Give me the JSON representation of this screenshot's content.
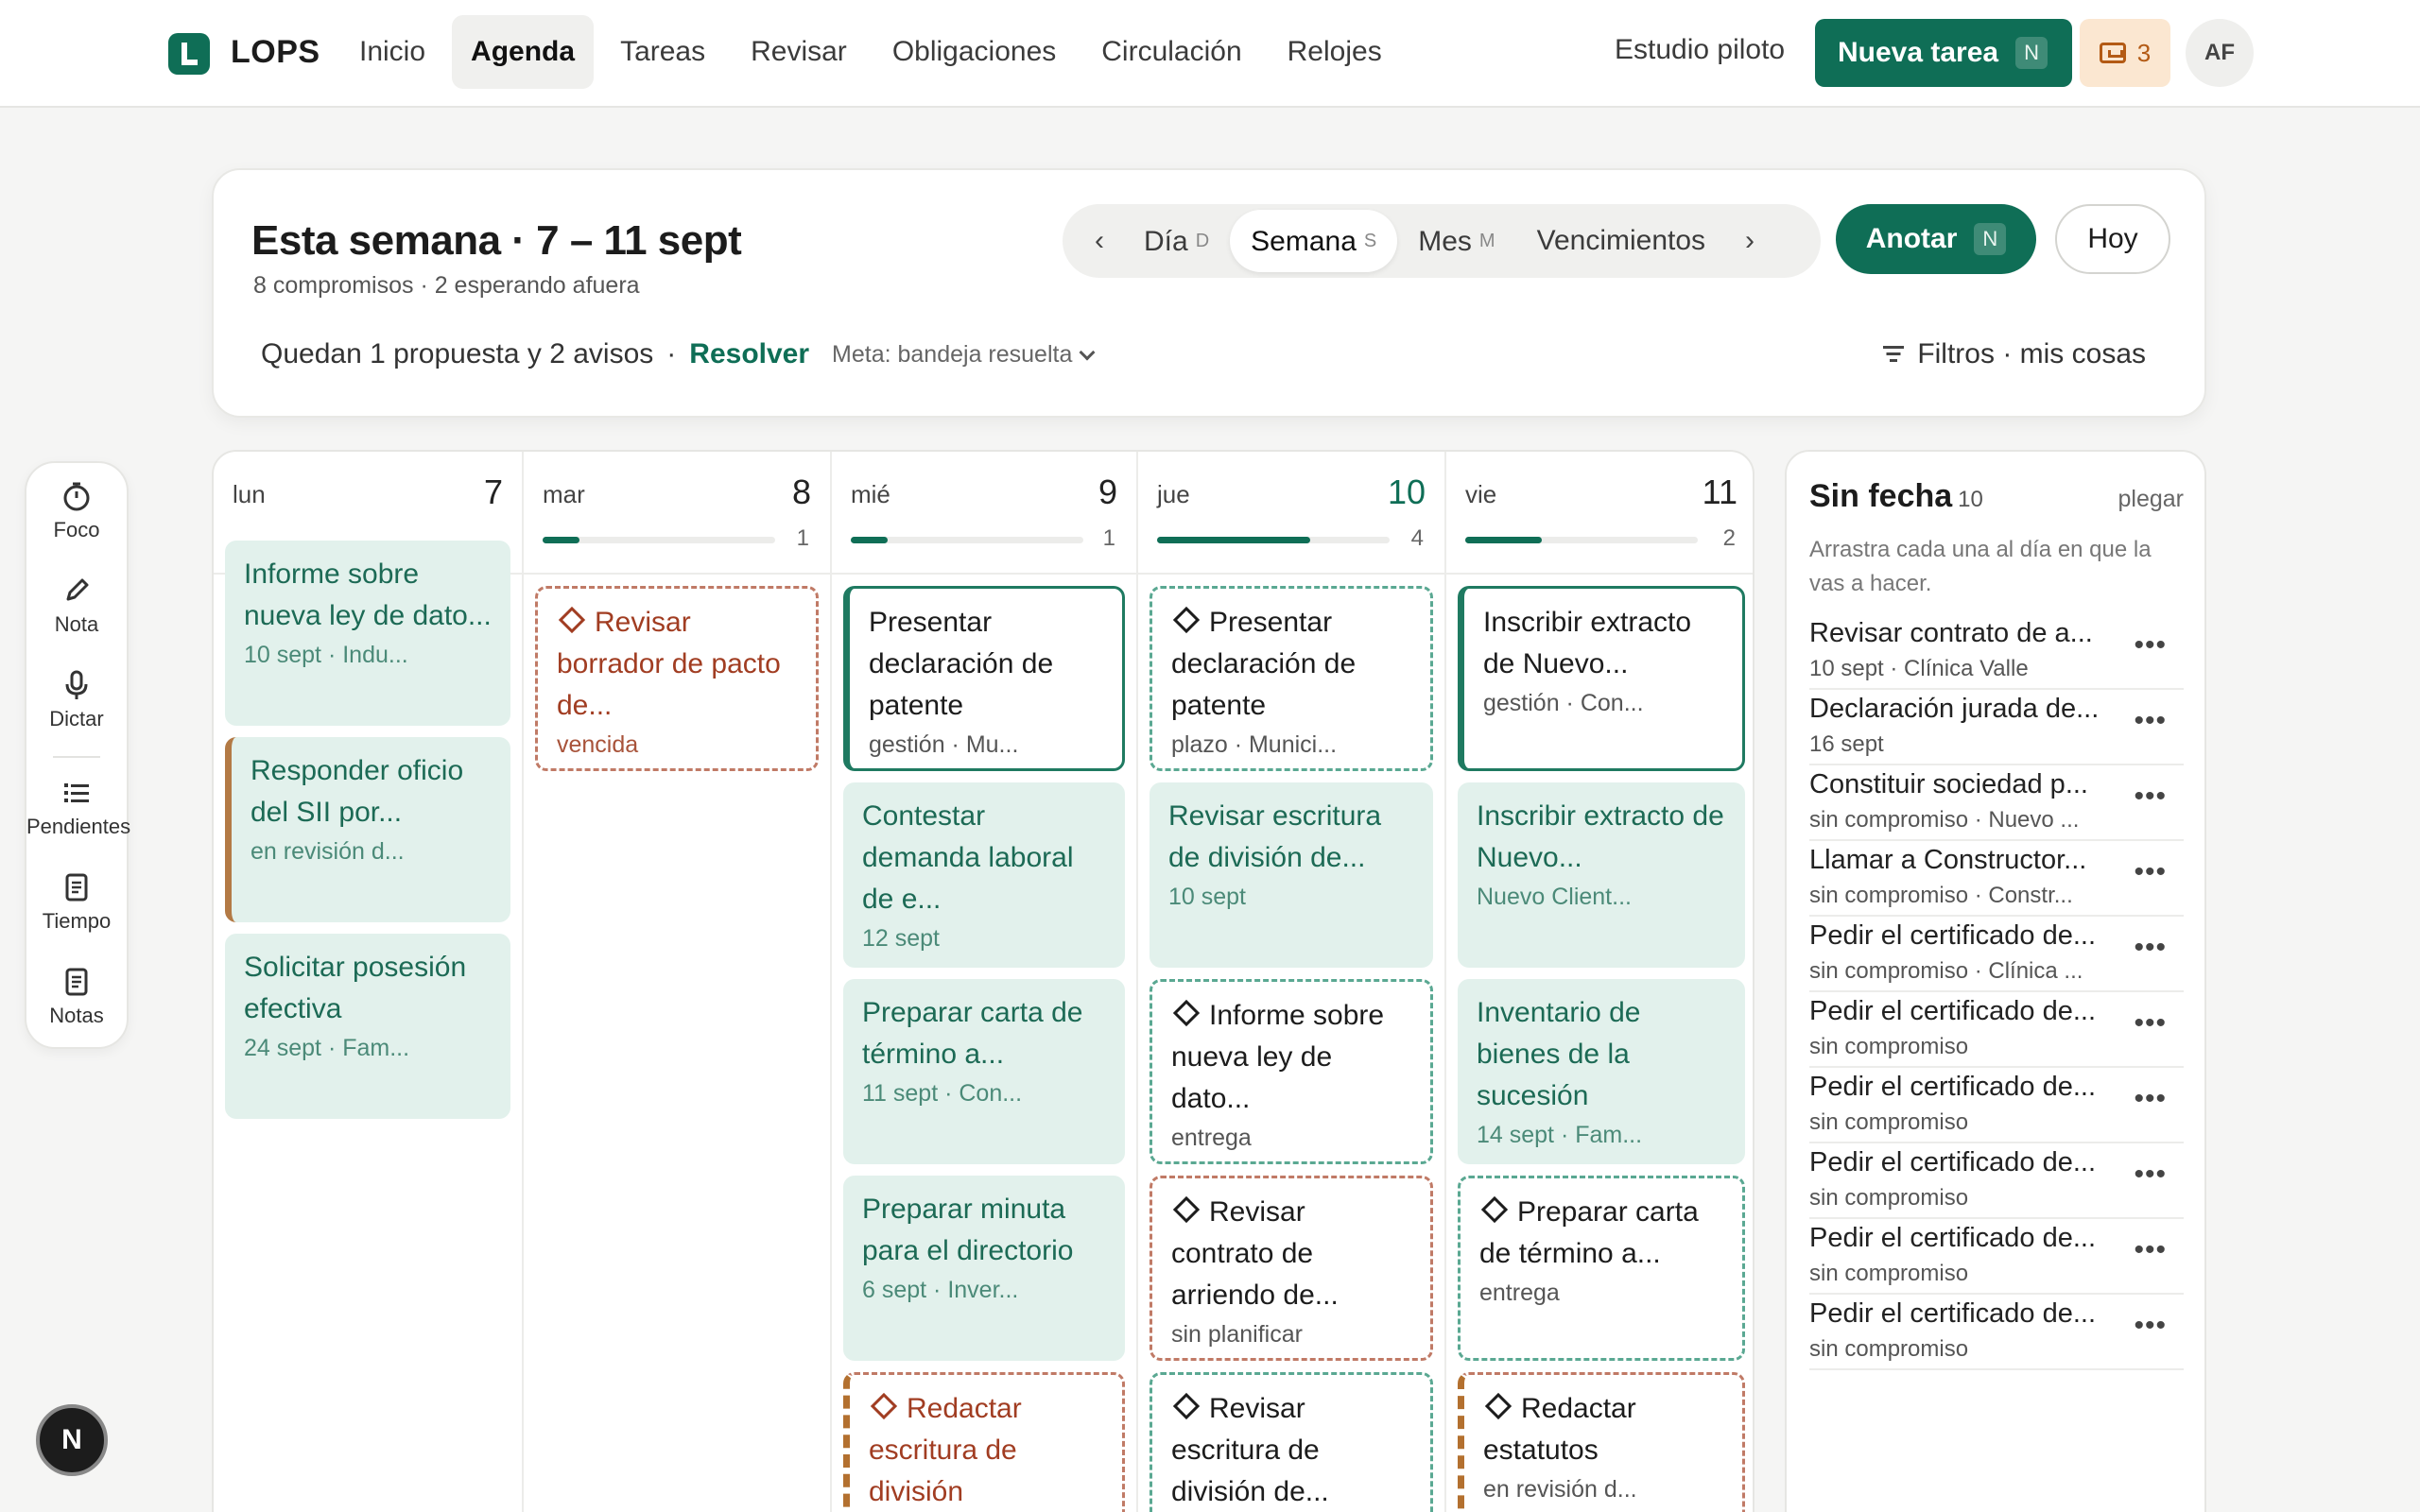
{
  "app": {
    "brand": "LOPS",
    "nav": [
      "Inicio",
      "Agenda",
      "Tareas",
      "Revisar",
      "Obligaciones",
      "Circulación",
      "Relojes"
    ],
    "workspace": "Estudio piloto",
    "new_task_label": "Nueva tarea",
    "new_task_shortcut": "N",
    "inbox_count": "3",
    "avatar_initials": "AF",
    "accent_color": "#0f6e56"
  },
  "header": {
    "title": "Esta semana · 7 – 11 sept",
    "subtitle": "8 compromisos · 2 esperando afuera",
    "prev": "‹",
    "next": "›",
    "views": [
      {
        "label": "Día",
        "shortcut": "D"
      },
      {
        "label": "Semana",
        "shortcut": "S"
      },
      {
        "label": "Mes",
        "shortcut": "M"
      },
      {
        "label": "Vencimientos",
        "shortcut": ""
      }
    ],
    "active_view": "Semana",
    "annotate_label": "Anotar",
    "annotate_shortcut": "N",
    "today_label": "Hoy",
    "pending_text": "Quedan 1 propuesta y 2 avisos",
    "separator": "·",
    "resolve_label": "Resolver",
    "goal_label": "Meta: bandeja resuelta",
    "filters_label": "Filtros · mis cosas"
  },
  "rail": {
    "items": [
      {
        "label": "Foco",
        "icon": "timer-icon"
      },
      {
        "label": "Nota",
        "icon": "pencil-icon"
      },
      {
        "label": "Dictar",
        "icon": "microphone-icon"
      },
      {
        "label": "Pendientes",
        "icon": "list-icon"
      },
      {
        "label": "Tiempo",
        "icon": "document-icon"
      },
      {
        "label": "Notas",
        "icon": "document-icon"
      }
    ]
  },
  "calendar": {
    "days": [
      {
        "name": "lun",
        "number": "7",
        "today": false,
        "progress": null,
        "count": "",
        "cards": [
          {
            "title": "Informe sobre nueva ley de dato...",
            "sub": "10 sept · Indu...",
            "style": "c-mint"
          },
          {
            "title": "Responder oficio del SII por...",
            "sub": "en revisión d...",
            "style": "c-mint-left"
          },
          {
            "title": "Solicitar posesión efectiva",
            "sub": "24 sept · Fam...",
            "style": "c-mint"
          }
        ]
      },
      {
        "name": "mar",
        "number": "8",
        "today": false,
        "progress": 0.16,
        "count": "1",
        "cards": [
          {
            "title": "Revisar borrador de pacto de...",
            "sub": "vencida",
            "style": "c-dash-red",
            "diamond": true
          }
        ]
      },
      {
        "name": "mié",
        "number": "9",
        "today": false,
        "progress": 0.16,
        "count": "1",
        "cards": [
          {
            "title": "Presentar declaración de patente",
            "sub": "gestión · Mu...",
            "style": "c-solid"
          },
          {
            "title": "Contestar demanda laboral de e...",
            "sub": "12 sept",
            "style": "c-mint"
          },
          {
            "title": "Preparar carta de término a...",
            "sub": "11 sept · Con...",
            "style": "c-mint"
          },
          {
            "title": "Preparar minuta para el directorio",
            "sub": "6 sept · Inver...",
            "style": "c-mint"
          },
          {
            "title": "Redactar escritura de división",
            "sub": "",
            "style": "c-dash-red-left",
            "diamond": true
          }
        ]
      },
      {
        "name": "jue",
        "number": "10",
        "today": true,
        "progress": 0.66,
        "count": "4",
        "cards": [
          {
            "title": "Presentar declaración de patente",
            "sub": "plazo · Munici...",
            "style": "c-dash-green",
            "diamond": true
          },
          {
            "title": "Revisar escritura de división de...",
            "sub": "10 sept",
            "style": "c-mint"
          },
          {
            "title": "Informe sobre nueva ley de dato...",
            "sub": "entrega",
            "style": "c-dash-green",
            "diamond": true
          },
          {
            "title": "Revisar contrato de arriendo de...",
            "sub": "sin planificar",
            "style": "c-dash-red-plain",
            "diamond": true
          },
          {
            "title": "Revisar escritura de división de...",
            "sub": "",
            "style": "c-dash-green",
            "diamond": true
          }
        ]
      },
      {
        "name": "vie",
        "number": "11",
        "today": false,
        "progress": 0.33,
        "count": "2",
        "cards": [
          {
            "title": "Inscribir extracto de Nuevo...",
            "sub": "gestión · Con...",
            "style": "c-solid"
          },
          {
            "title": "Inscribir extracto de Nuevo...",
            "sub": "Nuevo Client...",
            "style": "c-mint"
          },
          {
            "title": "Inventario de bienes de la sucesión",
            "sub": "14 sept · Fam...",
            "style": "c-mint"
          },
          {
            "title": "Preparar carta de término a...",
            "sub": "entrega",
            "style": "c-dash-green",
            "diamond": true
          },
          {
            "title": "Redactar estatutos",
            "sub": "en revisión d...",
            "style": "c-dash-red-left-plain",
            "diamond": true
          }
        ]
      }
    ]
  },
  "undated": {
    "title": "Sin fecha",
    "count": "10",
    "fold_label": "plegar",
    "hint": "Arrastra cada una al día en que la vas a hacer.",
    "more_label": "•••",
    "items": [
      {
        "title": "Revisar contrato de a...",
        "sub": "10 sept · Clínica Valle"
      },
      {
        "title": "Declaración jurada de...",
        "sub": "16 sept"
      },
      {
        "title": "Constituir sociedad p...",
        "sub": "sin compromiso · Nuevo ..."
      },
      {
        "title": "Llamar a Constructor...",
        "sub": "sin compromiso · Constr..."
      },
      {
        "title": "Pedir el certificado de...",
        "sub": "sin compromiso · Clínica ..."
      },
      {
        "title": "Pedir el certificado de...",
        "sub": "sin compromiso"
      },
      {
        "title": "Pedir el certificado de...",
        "sub": "sin compromiso"
      },
      {
        "title": "Pedir el certificado de...",
        "sub": "sin compromiso"
      },
      {
        "title": "Pedir el certificado de...",
        "sub": "sin compromiso"
      },
      {
        "title": "Pedir el certificado de...",
        "sub": "sin compromiso"
      }
    ]
  },
  "fab_label": "N"
}
